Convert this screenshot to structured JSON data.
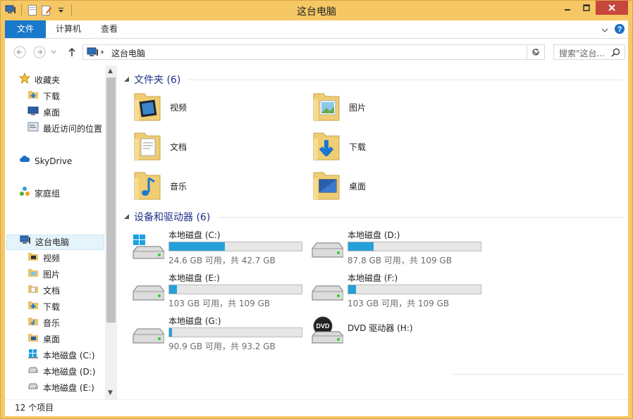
{
  "window": {
    "title": "这台电脑"
  },
  "ribbon": {
    "tabs": [
      {
        "label": "文件"
      },
      {
        "label": "计算机"
      },
      {
        "label": "查看"
      }
    ]
  },
  "address": {
    "crumb": "这台电脑",
    "search_placeholder": "搜索\"这台..."
  },
  "sidebar": {
    "items": [
      {
        "label": "收藏夹",
        "icon": "star-icon"
      },
      {
        "label": "下载",
        "icon": "downloads-folder-icon"
      },
      {
        "label": "桌面",
        "icon": "desktop-icon"
      },
      {
        "label": "最近访问的位置",
        "icon": "recent-places-icon"
      },
      {
        "label": "SkyDrive",
        "icon": "cloud-icon"
      },
      {
        "label": "家庭组",
        "icon": "homegroup-icon"
      },
      {
        "label": "这台电脑",
        "icon": "computer-icon"
      },
      {
        "label": "视频",
        "icon": "videos-folder-icon"
      },
      {
        "label": "图片",
        "icon": "pictures-folder-icon"
      },
      {
        "label": "文档",
        "icon": "documents-folder-icon"
      },
      {
        "label": "下载",
        "icon": "downloads-folder-icon"
      },
      {
        "label": "音乐",
        "icon": "music-folder-icon"
      },
      {
        "label": "桌面",
        "icon": "desktop-folder-icon"
      },
      {
        "label": "本地磁盘 (C:)",
        "icon": "system-drive-icon"
      },
      {
        "label": "本地磁盘 (D:)",
        "icon": "drive-icon"
      },
      {
        "label": "本地磁盘 (E:)",
        "icon": "drive-icon"
      }
    ]
  },
  "folders_group": {
    "title": "文件夹 (6)"
  },
  "folders": [
    {
      "label": "视频",
      "icon": "videos-folder-icon"
    },
    {
      "label": "图片",
      "icon": "pictures-folder-icon"
    },
    {
      "label": "文档",
      "icon": "documents-folder-icon"
    },
    {
      "label": "下载",
      "icon": "downloads-folder-icon"
    },
    {
      "label": "音乐",
      "icon": "music-folder-icon"
    },
    {
      "label": "桌面",
      "icon": "desktop-folder-icon"
    }
  ],
  "drives_group": {
    "title": "设备和驱动器 (6)"
  },
  "drives": [
    {
      "name": "本地磁盘 (C:)",
      "size": "24.6 GB 可用，共 42.7 GB",
      "used_fraction": 0.42,
      "icon": "system-drive-icon"
    },
    {
      "name": "本地磁盘 (D:)",
      "size": "87.8 GB 可用，共 109 GB",
      "used_fraction": 0.19,
      "icon": "drive-icon"
    },
    {
      "name": "本地磁盘 (E:)",
      "size": "103 GB 可用，共 109 GB",
      "used_fraction": 0.06,
      "icon": "drive-icon"
    },
    {
      "name": "本地磁盘 (F:)",
      "size": "103 GB 可用，共 109 GB",
      "used_fraction": 0.06,
      "icon": "drive-icon"
    },
    {
      "name": "本地磁盘 (G:)",
      "size": "90.9 GB 可用，共 93.2 GB",
      "used_fraction": 0.02,
      "icon": "drive-icon"
    },
    {
      "name": "DVD 驱动器 (H:)",
      "icon": "dvd-drive-icon"
    }
  ],
  "status": {
    "text": "12 个项目"
  },
  "colors": {
    "accent": "#1979ca",
    "frame": "#f6c765",
    "bar_fill": "#26a0da",
    "group_title": "#1e3287"
  }
}
